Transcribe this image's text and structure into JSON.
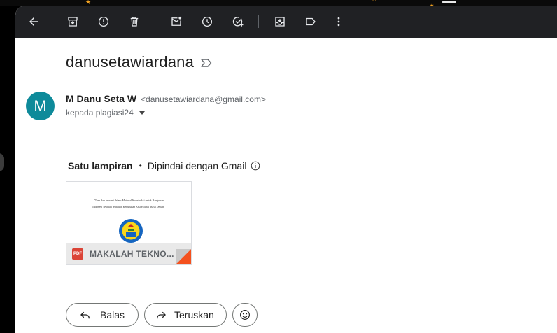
{
  "toolbar": {
    "icons": [
      "back-arrow-icon",
      "archive-icon",
      "report-spam-icon",
      "delete-icon",
      "mark-unread-icon",
      "snooze-icon",
      "add-to-tasks-icon",
      "move-to-icon",
      "label-icon",
      "more-vert-icon"
    ]
  },
  "email": {
    "subject": "danusetawiardana",
    "sender_initial": "M",
    "sender_name": "M Danu Seta W",
    "sender_email": "<danusetawiardana@gmail.com>",
    "recipient": "kepada plagiasi24"
  },
  "attachments": {
    "title": "Satu lampiran",
    "scan_note": "Dipindai dengan Gmail",
    "file": {
      "type_badge": "PDF",
      "name": "MAKALAH TEKNO...",
      "preview_title_line1": "\"Tren dan Inovasi dalam Material Konstruksi untuk Bangunan",
      "preview_title_line2": "Indonesi : Kajian terhadap Kebutuhan Arsitektural Masa Depan\""
    }
  },
  "actions": {
    "reply_label": "Balas",
    "forward_label": "Teruskan"
  },
  "colors": {
    "toolbar_bg": "#202124",
    "avatar_bg": "#0e8a9a",
    "pdf_red": "#db4437",
    "corner_accent": "#f4511e"
  }
}
